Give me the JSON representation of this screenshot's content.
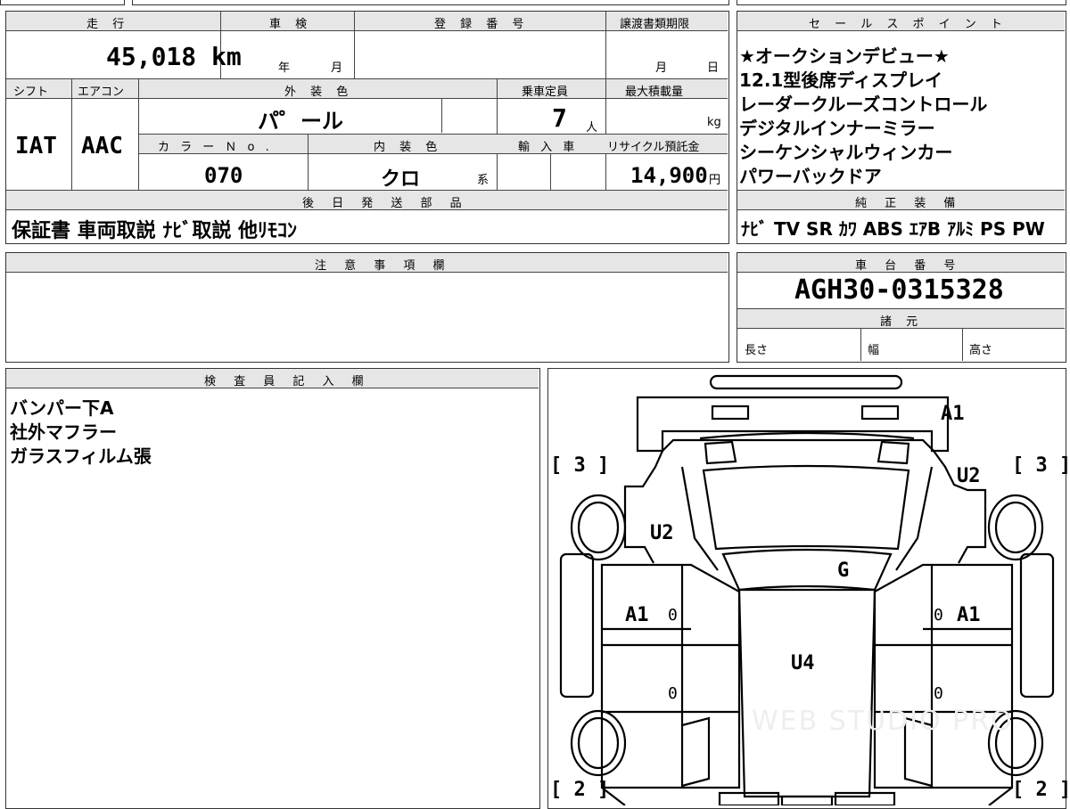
{
  "top_left": {
    "h_mileage": "走 行",
    "h_shaken": "車 検",
    "h_reg": "登 録 番 号",
    "h_transfer": "譲渡書類期限",
    "mileage": "45,018 km",
    "year_unit": "年",
    "month_unit": "月",
    "transfer_month": "月",
    "transfer_day": "日",
    "h_shift": "シフト",
    "h_ac": "エアコン",
    "h_ext_color": "外 装 色",
    "h_capacity": "乗車定員",
    "h_max_load": "最大積載量",
    "shift": "IAT",
    "ac": "AAC",
    "ext_color": "パ゜ール",
    "capacity": "7",
    "capacity_unit": "人",
    "load_unit": "kg",
    "h_color_no": "カ ラ ー Ｎ o .",
    "h_int_color": "内 装 色",
    "h_import": "輸 入 車",
    "h_recycle": "リサイクル預託金",
    "color_no": "070",
    "int_color": "クロ",
    "int_suffix": "系",
    "recycle": "14,900",
    "recycle_unit": "円",
    "h_later": "後 日 発 送 部 品",
    "later_parts": "保証書 車両取説 ﾅﾋﾞ取説 他ﾘﾓｺﾝ"
  },
  "sales": {
    "header": "セ ー ル ス ポ イ ン ト",
    "points": [
      "★オークションデビュー★",
      "12.1型後席ディスプレイ",
      "レーダークルーズコントロール",
      "デジタルインナーミラー",
      "シーケンシャルウィンカー",
      "パワーバックドア"
    ],
    "h_equipment": "純 正 装 備",
    "equipment": "ﾅﾋﾞ TV SR ｶﾜ ABS ｴｱB ｱﾙﾐ PS PW"
  },
  "notes": {
    "header": "注 意 事 項 欄"
  },
  "chassis": {
    "header": "車 台 番 号",
    "number": "AGH30-0315328",
    "h_specs": "諸 元",
    "length": "長さ",
    "width": "幅",
    "height": "高さ"
  },
  "inspector": {
    "header": "検 査 員 記 入 欄",
    "lines": [
      "バンパー下A",
      "社外マフラー",
      "ガラスフィルム張"
    ]
  },
  "diagram": {
    "marks": {
      "a1_rear": "A1",
      "u2_right": "U2",
      "u2_left": "U2",
      "g_windshield": "G",
      "a1_left": "A1",
      "a1_right": "A1",
      "u4_roof": "U4"
    },
    "tires": {
      "rear_left": "[ 3 ]",
      "rear_right": "[ 3 ]",
      "front_left": "[ 2 ]",
      "front_right": "[ 2 ]"
    },
    "zeros": [
      "0",
      "0",
      "0",
      "0"
    ],
    "watermark": "WEB STUDIO PRO"
  }
}
